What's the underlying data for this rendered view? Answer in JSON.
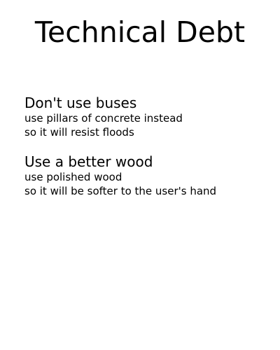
{
  "page": {
    "title": "Technical Debt"
  },
  "items": [
    {
      "heading": "Don't use buses",
      "lines": [
        "use pillars of concrete instead",
        "so it will resist floods"
      ]
    },
    {
      "heading": "Use a better wood",
      "lines": [
        "use polished wood",
        "so it will be softer to the user's hand"
      ]
    }
  ]
}
